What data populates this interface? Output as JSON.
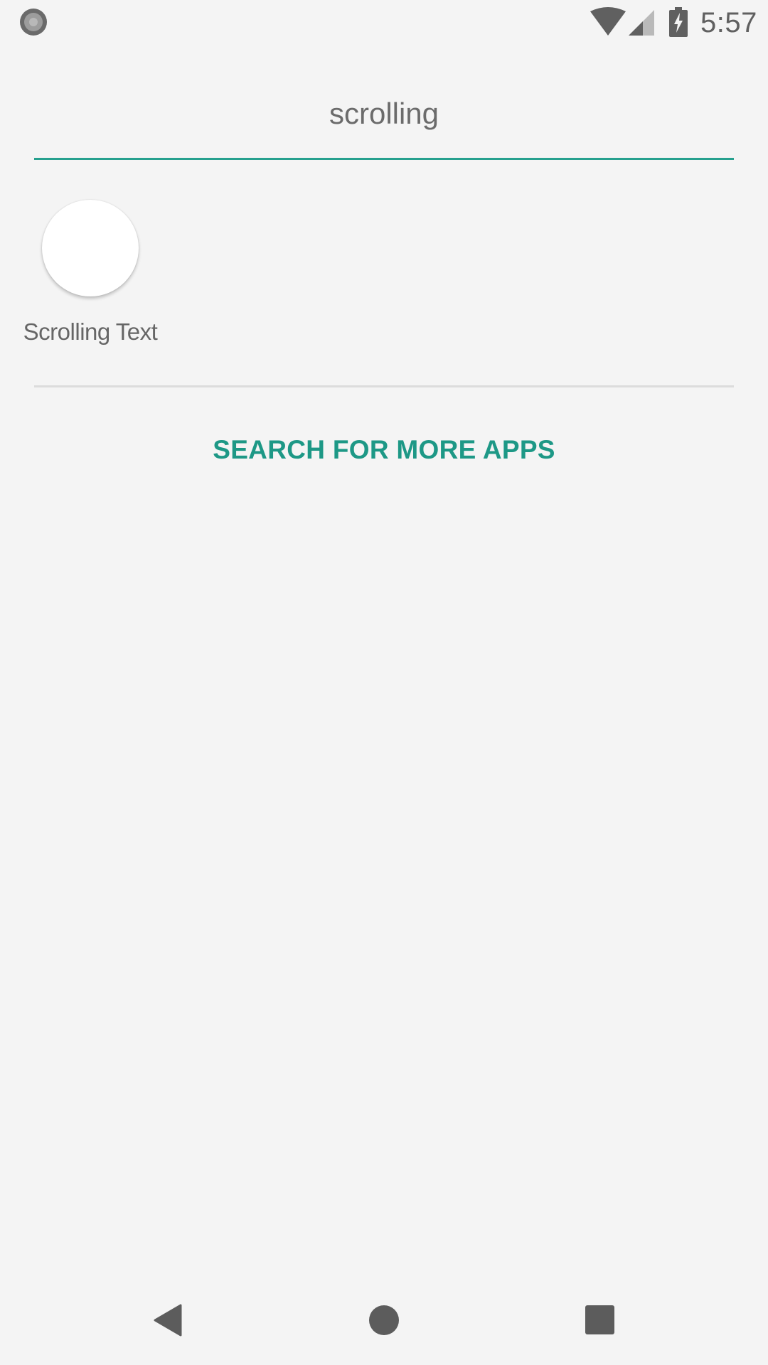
{
  "status_bar": {
    "time": "5:57",
    "icons": [
      "notification-icon",
      "wifi-icon",
      "cell-signal-icon",
      "battery-charging-icon"
    ]
  },
  "search": {
    "value": "scrolling",
    "accent_color": "#26a08e"
  },
  "results": [
    {
      "label": "Scrolling Text",
      "icon": "app-icon-blank"
    }
  ],
  "more_apps": {
    "label": "SEARCH FOR MORE APPS",
    "color": "#1d9886"
  },
  "nav_bar": {
    "icons": [
      "back-icon",
      "home-icon",
      "recents-icon"
    ]
  }
}
